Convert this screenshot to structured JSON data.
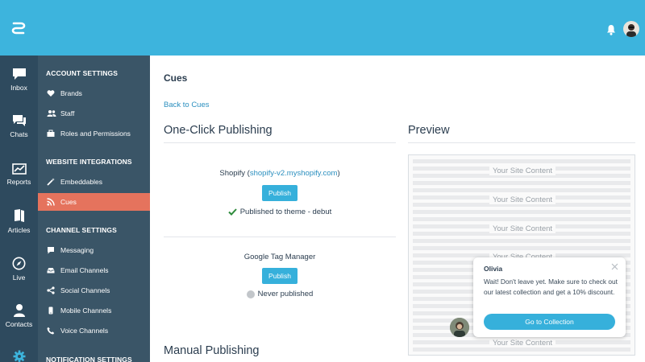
{
  "rail": {
    "items": [
      {
        "label": "Inbox",
        "icon": "inbox-icon"
      },
      {
        "label": "Chats",
        "icon": "chats-icon"
      },
      {
        "label": "Reports",
        "icon": "reports-icon"
      },
      {
        "label": "Articles",
        "icon": "articles-icon"
      },
      {
        "label": "Live",
        "icon": "compass-icon"
      },
      {
        "label": "Contacts",
        "icon": "contacts-icon"
      }
    ],
    "settings_icon": "gear-icon"
  },
  "sidebar": {
    "sections": [
      {
        "title": "ACCOUNT SETTINGS",
        "items": [
          {
            "label": "Brands",
            "icon": "heart-icon"
          },
          {
            "label": "Staff",
            "icon": "staff-icon"
          },
          {
            "label": "Roles and Permissions",
            "icon": "briefcase-icon"
          }
        ]
      },
      {
        "title": "WEBSITE INTEGRATIONS",
        "items": [
          {
            "label": "Embeddables",
            "icon": "wand-icon"
          },
          {
            "label": "Cues",
            "icon": "rss-icon",
            "active": true
          }
        ]
      },
      {
        "title": "CHANNEL SETTINGS",
        "items": [
          {
            "label": "Messaging",
            "icon": "messaging-icon"
          },
          {
            "label": "Email Channels",
            "icon": "email-icon"
          },
          {
            "label": "Social Channels",
            "icon": "share-icon"
          },
          {
            "label": "Mobile Channels",
            "icon": "mobile-icon"
          },
          {
            "label": "Voice Channels",
            "icon": "phone-icon"
          }
        ]
      },
      {
        "title": "NOTIFICATION SETTINGS",
        "items": []
      }
    ]
  },
  "main": {
    "title": "Cues",
    "back_link": "Back to Cues",
    "one_click_title": "One-Click Publishing",
    "preview_title": "Preview",
    "shopify": {
      "name": "Shopify",
      "open_paren": " (",
      "link": "shopify-v2.myshopify.com",
      "close_paren": ")",
      "button": "Publish",
      "status": "Published to theme - debut"
    },
    "gtm": {
      "name": "Google Tag Manager",
      "button": "Publish",
      "status": "Never published"
    },
    "manual_title": "Manual Publishing"
  },
  "preview": {
    "site_text": "Your Site Content",
    "popup": {
      "name": "Olivia",
      "message": "Wait! Don't leave yet. Make sure to check out our latest collection and get a 10% discount.",
      "button": "Go to Collection"
    }
  },
  "colors": {
    "topbar": "#3db4dd",
    "rail": "#2e4a5e",
    "sidebar": "#3a5567",
    "active": "#e5735d",
    "accent": "#36b0db",
    "success": "#2e8b3c"
  }
}
